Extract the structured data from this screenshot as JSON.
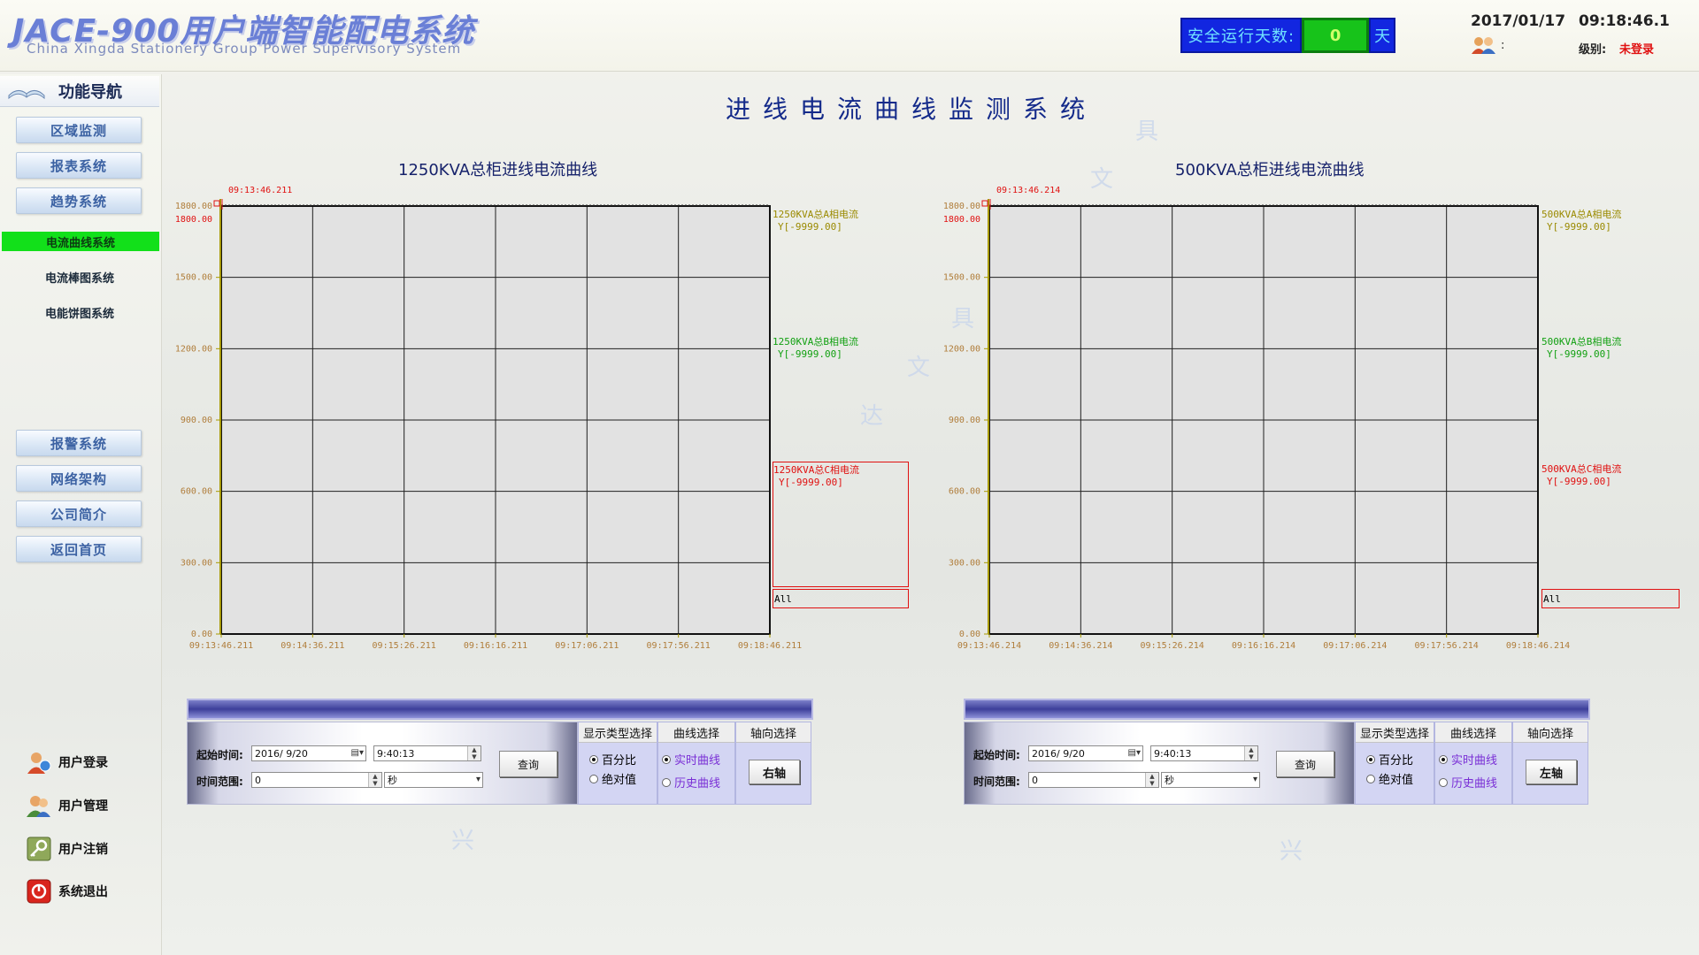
{
  "header": {
    "title": "JACE-900用户端智能配电系统",
    "subtitle": "China Xingda Stationery Group Power Supervisory System",
    "safe_days_label": "安全运行天数:",
    "safe_days_value": "0",
    "safe_days_unit": "天",
    "date": "2017/01/17",
    "time": "09:18:46.1",
    "user_colon": ":",
    "level_label": "级别:",
    "level_value": "未登录"
  },
  "sidebar": {
    "nav_title": "功能导航",
    "buttons": [
      "区域监测",
      "报表系统",
      "趋势系统"
    ],
    "sub_items": [
      "电流曲线系统",
      "电流棒图系统",
      "电能饼图系统"
    ],
    "buttons2": [
      "报警系统",
      "网络架构",
      "公司简介",
      "返回首页"
    ],
    "user_items": [
      "用户登录",
      "用户管理",
      "用户注销",
      "系统退出"
    ]
  },
  "main": {
    "page_title": "进线电流曲线监测系统",
    "watermark_chars": [
      "具",
      "文",
      "达",
      "兴"
    ]
  },
  "charts": [
    {
      "title": "1250KVA总柜进线电流曲线",
      "start_marker": "09:13:46.211",
      "legend": [
        {
          "name": "1250KVA总A相电流",
          "value": "Y[-9999.00]",
          "color": "#9a8a00"
        },
        {
          "name": "1250KVA总B相电流",
          "value": "Y[-9999.00]",
          "color": "#11a011"
        },
        {
          "name": "1250KVA总C相电流",
          "value": "Y[-9999.00]",
          "color": "#e01010"
        }
      ],
      "all_label": "All",
      "control": {
        "start_label": "起始时间:",
        "start_date": "2016/ 9/20",
        "start_time": "9:40:13",
        "range_label": "时间范围:",
        "range_value": "0",
        "range_unit": "秒",
        "query_label": "查询",
        "display_head": "显示类型选择",
        "display_opts": [
          "百分比",
          "绝对值"
        ],
        "curve_head": "曲线选择",
        "curve_opts": [
          "实时曲线",
          "历史曲线"
        ],
        "axis_head": "轴向选择",
        "axis_btn": "右轴"
      }
    },
    {
      "title": "500KVA总柜进线电流曲线",
      "start_marker": "09:13:46.214",
      "legend": [
        {
          "name": "500KVA总A相电流",
          "value": "Y[-9999.00]",
          "color": "#9a8a00"
        },
        {
          "name": "500KVA总B相电流",
          "value": "Y[-9999.00]",
          "color": "#11a011"
        },
        {
          "name": "500KVA总C相电流",
          "value": "Y[-9999.00]",
          "color": "#e01010"
        }
      ],
      "all_label": "All",
      "control": {
        "start_label": "起始时间:",
        "start_date": "2016/ 9/20",
        "start_time": "9:40:13",
        "range_label": "时间范围:",
        "range_value": "0",
        "range_unit": "秒",
        "query_label": "查询",
        "display_head": "显示类型选择",
        "display_opts": [
          "百分比",
          "绝对值"
        ],
        "curve_head": "曲线选择",
        "curve_opts": [
          "实时曲线",
          "历史曲线"
        ],
        "axis_head": "轴向选择",
        "axis_btn": "左轴"
      }
    }
  ],
  "chart_data": [
    {
      "type": "line",
      "title": "1250KVA总柜进线电流曲线",
      "ylim": [
        0,
        1800
      ],
      "y_ticks": [
        "0.00",
        "300.00",
        "600.00",
        "900.00",
        "1200.00",
        "1500.00",
        "1800.00"
      ],
      "y_top_label": "1800.00",
      "x_ticks": [
        "09:13:46.211",
        "09:14:36.211",
        "09:15:26.211",
        "09:16:16.211",
        "09:17:06.211",
        "09:17:56.211",
        "09:18:46.211"
      ],
      "grid": true,
      "series": [
        {
          "name": "1250KVA总A相电流",
          "values": []
        },
        {
          "name": "1250KVA总B相电流",
          "values": []
        },
        {
          "name": "1250KVA总C相电流",
          "values": []
        }
      ]
    },
    {
      "type": "line",
      "title": "500KVA总柜进线电流曲线",
      "ylim": [
        0,
        1800
      ],
      "y_ticks": [
        "0.00",
        "300.00",
        "600.00",
        "900.00",
        "1200.00",
        "1500.00",
        "1800.00"
      ],
      "y_top_label": "1800.00",
      "x_ticks": [
        "09:13:46.214",
        "09:14:36.214",
        "09:15:26.214",
        "09:16:16.214",
        "09:17:06.214",
        "09:17:56.214",
        "09:18:46.214"
      ],
      "grid": true,
      "series": [
        {
          "name": "500KVA总A相电流",
          "values": []
        },
        {
          "name": "500KVA总B相电流",
          "values": []
        },
        {
          "name": "500KVA总C相电流",
          "values": []
        }
      ]
    }
  ]
}
